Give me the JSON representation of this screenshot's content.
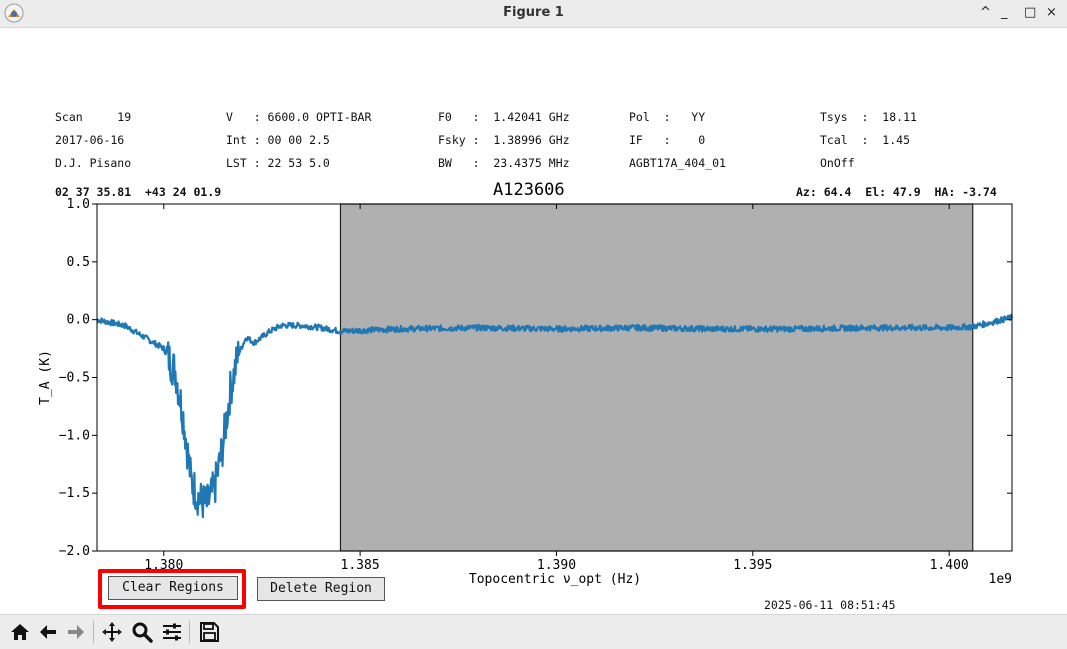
{
  "window": {
    "title": "Figure 1",
    "controls": [
      "^",
      "_",
      "□",
      "×"
    ]
  },
  "header": {
    "col1": [
      "Scan     19",
      "2017-06-16",
      "D.J. Pisano"
    ],
    "col2": [
      "V   : 6600.0 OPTI-BAR",
      "Int : 00 00 2.5",
      "LST : 22 53 5.0"
    ],
    "col3": [
      "F0   :  1.42041 GHz",
      "Fsky :  1.38996 GHz",
      "BW   :  23.4375 MHz"
    ],
    "col4": [
      "Pol  :   YY",
      "IF   :    0",
      "AGBT17A_404_01"
    ],
    "col5": [
      "Tsys  :  18.11",
      "Tcal  :  1.45",
      "OnOff"
    ],
    "coords": "02 37 35.81  +43 24 01.9",
    "source": "A123606",
    "azel": "Az: 64.4  El: 47.9  HA: -3.74"
  },
  "chart_data": {
    "type": "line",
    "xlabel": "Topocentric ν_opt (Hz)",
    "ylabel": "T_A (K)",
    "x_offset_label": "1e9",
    "xlim": [
      1.3783,
      1.4016
    ],
    "ylim": [
      -2.0,
      1.0
    ],
    "xticks": [
      1.38,
      1.385,
      1.39,
      1.395,
      1.4
    ],
    "xtick_labels": [
      "1.380",
      "1.385",
      "1.390",
      "1.395",
      "1.400"
    ],
    "yticks": [
      1.0,
      0.5,
      0.0,
      -0.5,
      -1.0,
      -1.5,
      -2.0
    ],
    "ytick_labels": [
      "1.0",
      "0.5",
      "0.0",
      "−0.5",
      "−1.0",
      "−1.5",
      "−2.0"
    ],
    "shaded_region": [
      1.3845,
      1.4006
    ],
    "line_color": "#1f77b4",
    "region_color": "#b0b0b0",
    "series": [
      {
        "x": [
          1.3783,
          1.379,
          1.3795,
          1.38,
          1.3803,
          1.3805,
          1.3807,
          1.3809,
          1.3811,
          1.3813,
          1.3815,
          1.3817,
          1.3819,
          1.3821,
          1.3823,
          1.3827,
          1.383,
          1.3835,
          1.384,
          1.3845,
          1.386,
          1.388,
          1.39,
          1.392,
          1.394,
          1.396,
          1.398,
          1.4,
          1.4006,
          1.401,
          1.4016
        ],
        "y": [
          0.0,
          -0.05,
          -0.15,
          -0.25,
          -0.45,
          -0.85,
          -1.4,
          -1.55,
          -1.6,
          -1.45,
          -1.1,
          -0.6,
          -0.3,
          -0.15,
          -0.2,
          -0.1,
          -0.05,
          -0.05,
          -0.07,
          -0.1,
          -0.08,
          -0.07,
          -0.08,
          -0.07,
          -0.08,
          -0.08,
          -0.07,
          -0.07,
          -0.06,
          -0.03,
          0.02
        ]
      }
    ]
  },
  "buttons": {
    "clear_regions": "Clear Regions",
    "delete_region": "Delete Region"
  },
  "timestamp": "2025-06-11 08:51:45",
  "toolbar": [
    "home-icon",
    "back-icon",
    "forward-icon",
    "pan-icon",
    "zoom-icon",
    "configure-icon",
    "save-icon"
  ],
  "highlight_color": "#ff0000"
}
